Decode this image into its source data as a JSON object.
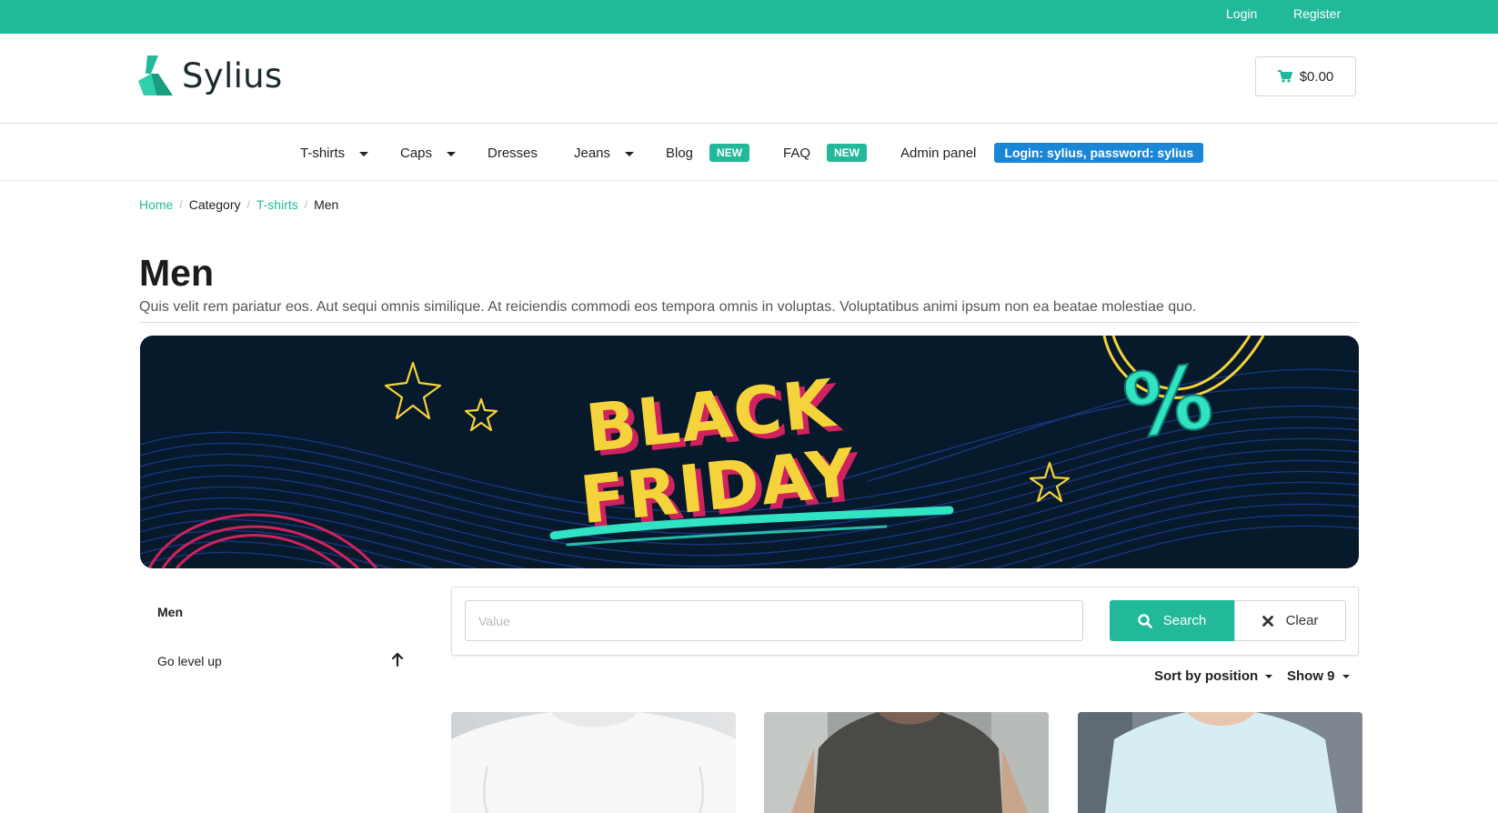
{
  "topbar": {
    "login": "Login",
    "register": "Register"
  },
  "header": {
    "logo_text": "Sylius",
    "cart_total": "$0.00"
  },
  "nav": {
    "items": [
      {
        "label": "T-shirts",
        "dropdown": true
      },
      {
        "label": "Caps",
        "dropdown": true
      },
      {
        "label": "Dresses",
        "dropdown": false
      },
      {
        "label": "Jeans",
        "dropdown": true
      },
      {
        "label": "Blog",
        "badge": "NEW"
      },
      {
        "label": "FAQ",
        "badge": "NEW"
      },
      {
        "label": "Admin panel",
        "badge": "Login: sylius, password: sylius"
      }
    ]
  },
  "breadcrumb": [
    {
      "label": "Home",
      "link": true
    },
    {
      "label": "Category",
      "link": false
    },
    {
      "label": "T-shirts",
      "link": true
    },
    {
      "label": "Men",
      "link": false
    }
  ],
  "page": {
    "title": "Men",
    "description": "Quis velit rem pariatur eos. Aut sequi omnis similique. At reiciendis commodi eos tempora omnis in voluptas. Voluptatibus animi ipsum non ea beatae molestiae quo."
  },
  "banner": {
    "line1": "BLACK",
    "line2": "FRIDAY",
    "symbol": "%"
  },
  "sidebar": {
    "current": "Men",
    "go_up": "Go level up"
  },
  "search": {
    "placeholder": "Value",
    "value": "",
    "search_label": "Search",
    "clear_label": "Clear"
  },
  "sorting": {
    "sort_label": "Sort by position",
    "show_label": "Show 9"
  },
  "colors": {
    "accent": "#22b99a",
    "info_badge": "#1c86d6",
    "banner_bg": "#061a2c",
    "banner_yellow": "#f5d33a",
    "banner_pink": "#d0225f",
    "banner_teal": "#2fe3c3"
  },
  "icons": {
    "cart": "cart-icon",
    "search": "search-icon",
    "clear": "close-icon",
    "go_up": "arrow-up-icon"
  }
}
